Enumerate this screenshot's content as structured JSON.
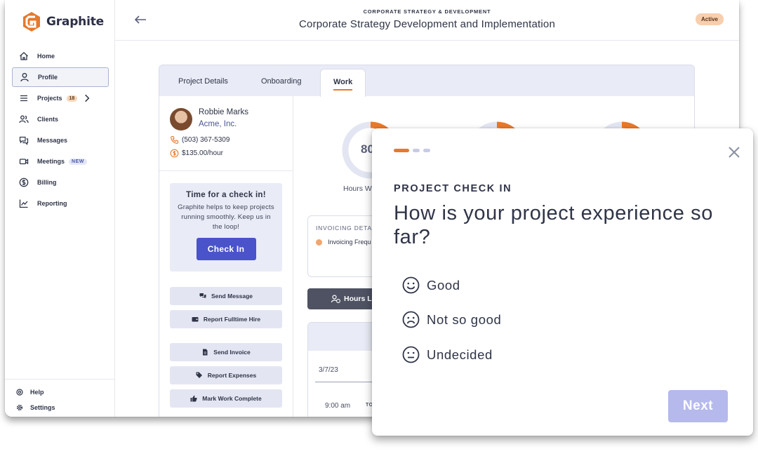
{
  "app": {
    "name": "Graphite"
  },
  "sidebar": {
    "items": [
      {
        "label": "Home",
        "icon": "home-icon"
      },
      {
        "label": "Profile",
        "icon": "user-icon",
        "active": true
      },
      {
        "label": "Projects",
        "icon": "list-icon",
        "badge": "18"
      },
      {
        "label": "Clients",
        "icon": "users-icon"
      },
      {
        "label": "Messages",
        "icon": "chat-icon"
      },
      {
        "label": "Meetings",
        "icon": "video-icon",
        "badge": "NEW"
      },
      {
        "label": "Billing",
        "icon": "dollar-icon"
      },
      {
        "label": "Reporting",
        "icon": "chart-icon"
      }
    ],
    "footer": [
      {
        "label": "Help",
        "icon": "help-icon"
      },
      {
        "label": "Settings",
        "icon": "gear-icon"
      }
    ]
  },
  "header": {
    "eyebrow": "CORPORATE STRATEGY & DEVELOPMENT",
    "title": "Corporate Strategy Development and Implementation",
    "status": "Active"
  },
  "tabs": [
    "Project Details",
    "Onboarding",
    "Work"
  ],
  "active_tab": "Work",
  "contact": {
    "name": "Robbie Marks",
    "company": "Acme, Inc.",
    "phone": "(503) 367-5309",
    "rate": "$135.00/hour"
  },
  "checkin_card": {
    "title": "Time for a check in!",
    "body": "Graphite helps to keep projects running smoothly. Keep us in the loop!",
    "button": "Check In"
  },
  "actions": [
    "Send Message",
    "Report Fulltime Hire",
    "Send Invoice",
    "Report Expenses",
    "Mark Work Complete"
  ],
  "work": {
    "donut_value": "80",
    "donut_label": "Hours W",
    "invoicing_title": "INVOICING DETAIL",
    "invoicing_line": "Invoicing Frequ",
    "hours_button": "Hours Lo",
    "log_date": "3/7/23",
    "log_time": "9:00 am",
    "log_to": "TO"
  },
  "modal": {
    "eyebrow": "PROJECT CHECK IN",
    "question": "How is your project experience so far?",
    "options": [
      {
        "label": "Good",
        "icon": "smile-face-icon"
      },
      {
        "label": "Not so good",
        "icon": "frown-face-icon"
      },
      {
        "label": "Undecided",
        "icon": "neutral-face-icon"
      }
    ],
    "next": "Next",
    "progress_steps": 3,
    "current_step": 1
  },
  "colors": {
    "accent_orange": "#e8792a",
    "primary_blue": "#4a53c9",
    "next_disabled": "#b5b9ec",
    "tab_bar": "#e9ebf6"
  }
}
